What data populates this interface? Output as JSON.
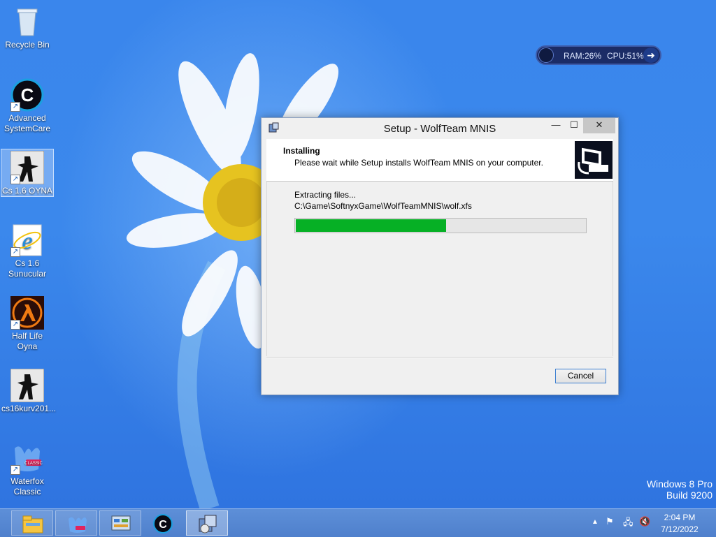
{
  "desktop": {
    "icons": [
      {
        "label": "Recycle Bin",
        "icon": "recycle-bin-icon"
      },
      {
        "label": "Advanced SystemCare",
        "icon": "advanced-systemcare-icon"
      },
      {
        "label": "Cs 1.6 OYNA",
        "icon": "counter-strike-icon"
      },
      {
        "label": "Cs 1.6 Sunucular",
        "icon": "internet-explorer-icon"
      },
      {
        "label": "Half Life Oyna",
        "icon": "half-life-icon"
      },
      {
        "label": "cs16kurv201...",
        "icon": "counter-strike-icon"
      },
      {
        "label": "Waterfox Classic",
        "icon": "waterfox-icon"
      }
    ],
    "watermark_line1": "Windows 8 Pro",
    "watermark_line2": "Build 9200"
  },
  "sysmon": {
    "ram": "RAM:26%",
    "cpu": "CPU:51%"
  },
  "setup": {
    "title": "Setup - WolfTeam MNIS",
    "minimize": "—",
    "maximize": "☐",
    "close": "✕",
    "header_title": "Installing",
    "header_subtitle": "Please wait while Setup installs WolfTeam MNIS on your computer.",
    "status": "Extracting files...",
    "file_path": "C:\\Game\\SoftnyxGame\\WolfTeamMNIS\\wolf.xfs",
    "progress": 0.52,
    "progress_color": "#06b025",
    "cancel_label": "Cancel"
  },
  "taskbar": {
    "items": [
      "file-explorer",
      "waterfox",
      "control-panel",
      "advanced-systemcare",
      "setup"
    ],
    "time": "2:04 PM",
    "date": "7/12/2022"
  }
}
